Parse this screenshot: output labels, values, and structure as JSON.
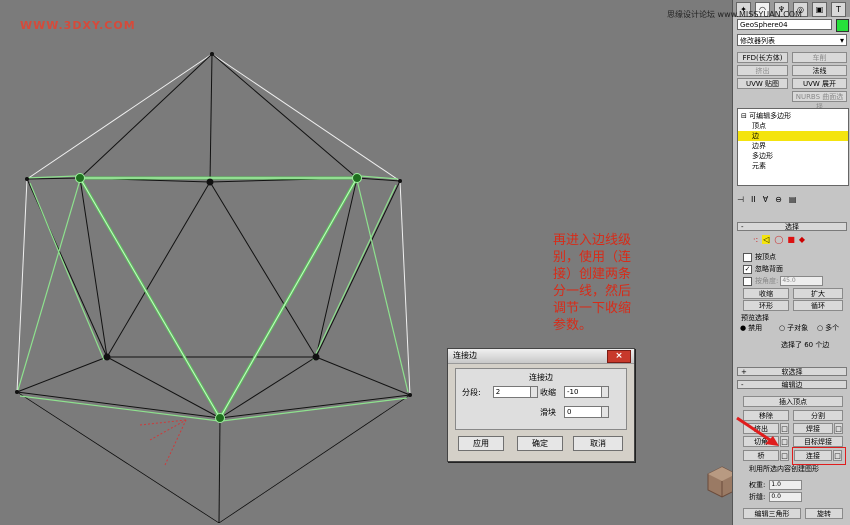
{
  "watermark": "WWW.3DXY.COM",
  "top_watermark": "思缘设计论坛 www.MISSYUAN.COM",
  "annotation_lines": [
    "再进入边线级",
    "别，使用（连",
    "接）创建两条",
    "分一线，然后",
    "调节一下收缩",
    "参数。"
  ],
  "dialog": {
    "title": "连接边",
    "group_title": "连接边",
    "segments_label": "分段:",
    "segments_value": "2",
    "pinch_label": "收缩",
    "pinch_value": "-10",
    "slide_label": "滑块",
    "slide_value": "0",
    "apply_button": "应用",
    "ok_button": "确定",
    "cancel_button": "取消"
  },
  "panel": {
    "object_name": "GeoSphere04",
    "object_color": "#27e03a",
    "modifier_list": "修改器列表",
    "buttons": {
      "ffd": "FFD(长方体)",
      "lathe": "车削",
      "extrude": "挤出",
      "normal": "法线",
      "uvw_map": "UVW 贴图",
      "uvw_unwrap": "UVW 展开",
      "nurbs": "NURBS 曲面选择"
    },
    "stack": {
      "root": "可编辑多边形",
      "items": [
        "顶点",
        "边",
        "边界",
        "多边形",
        "元素"
      ],
      "selected": "边"
    },
    "selection": {
      "rollout": "选择",
      "by_vertex": "按顶点",
      "ignore_backfacing": "忽略背面",
      "by_angle": "按角度:",
      "angle_value": "45.0",
      "shrink": "收缩",
      "grow": "扩大",
      "ring": "环形",
      "loop": "循环",
      "preview_title": "预览选择",
      "preview_disabled": "禁用",
      "preview_subobject": "子对象",
      "preview_multi": "多个",
      "status": "选择了 60 个边"
    },
    "soft_selection": "软选择",
    "edit_edges": {
      "rollout": "编辑边",
      "insert_vertex": "插入顶点",
      "remove": "移除",
      "split": "分割",
      "extrude": "挤出",
      "weld": "焊接",
      "chamfer": "切角",
      "target_weld": "目标焊接",
      "bridge": "桥",
      "connect": "连接",
      "create_shape": "利用所选内容创建图形",
      "weight_label": "权重:",
      "weight_value": "1.0",
      "crease_label": "折缝:",
      "crease_value": "0.0",
      "edit_tri": "编辑三角形",
      "turn": "旋转"
    }
  }
}
